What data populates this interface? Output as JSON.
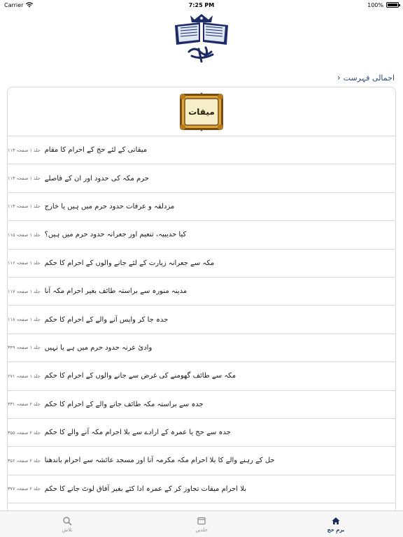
{
  "status": {
    "carrier": "Carrier",
    "time": "7:25 PM",
    "battery": "100%",
    "battery_level": 1.0
  },
  "logo": {
    "alt": "جلد اول"
  },
  "breadcrumb": {
    "label": "اجمالی فہرست"
  },
  "header": {
    "plaque_text": "میقات"
  },
  "items": [
    {
      "title": "میقاتی کے لئے حج کے احرام کا مقام",
      "ref": "جلد ۱ صفحہ ۱۱۳"
    },
    {
      "title": "حرم مکہ کی حدود اور ان کے فاصلے",
      "ref": "جلد ۱ صفحہ ۱۱۳"
    },
    {
      "title": "مزدلفہ و عرفات حدود حرم میں ہیں یا خارج",
      "ref": "جلد ۱ صفحہ ۱۱۳"
    },
    {
      "title": "کیا حدیبیہ، تنعیم اور جعرانہ حدود حرم میں ہیں؟",
      "ref": "جلد ۱ صفحہ ۱۱۵"
    },
    {
      "title": "مکہ سے جعرانہ زیارت کے لئے جانے والوں کے احرام کا حکم",
      "ref": "جلد ۱ صفحہ ۱۱۶"
    },
    {
      "title": "مدینہ منورہ سے براستہ طائف بغیر احرام مکہ آنا",
      "ref": "جلد ۱ صفحہ ۱۱۷"
    },
    {
      "title": "جدہ جا کر واپس آنے والے کے احرام کا حکم",
      "ref": "جلد ۱ صفحہ ۱۱۸"
    },
    {
      "title": "وادیٔ عرنہ حدود حرم میں ہے یا نہیں",
      "ref": "جلد ۱ صفحہ ۳۴۹"
    },
    {
      "title": "مکہ سے طائف گھومنے کی غرض سے جانے والوں کے احرام کا حکم",
      "ref": "جلد ۱ صفحہ ۲۷۱"
    },
    {
      "title": "جدہ سے براستہ مکہ طائف جانے والے کے احرام کا حکم",
      "ref": "جلد ۲ صفحہ ۳۳۱"
    },
    {
      "title": "جدہ سے حج یا عمرہ کے ارادے سے بلا احرام مکہ آنے والے کا حکم",
      "ref": "جلد ۲ صفحہ ۳۵۵"
    },
    {
      "title": "حل کے رہنے والے کا بلا احرام مکہ مکرمہ آنا اور مسجد عائشہ سے احرام باندھنا",
      "ref": "جلد ۲ صفحہ ۳۵۶"
    },
    {
      "title": "بلا احرام میقات تجاوز کر کے عمرہ ادا کئے بغیر آفاق لوٹ جانے کا حکم",
      "ref": "جلد ۲ صفحہ ۳۷۷"
    }
  ],
  "tabs": [
    {
      "label": "تلاش",
      "icon": "search-icon"
    },
    {
      "label": "جلدیں",
      "icon": "book-icon"
    },
    {
      "label": "بزمِ حج",
      "icon": "home-icon"
    }
  ],
  "colors": {
    "accent": "#1a2a5a",
    "breadcrumb": "#2b4a7a",
    "plaque_gold": "#d9a63a",
    "plaque_inner": "#f6edc9"
  }
}
